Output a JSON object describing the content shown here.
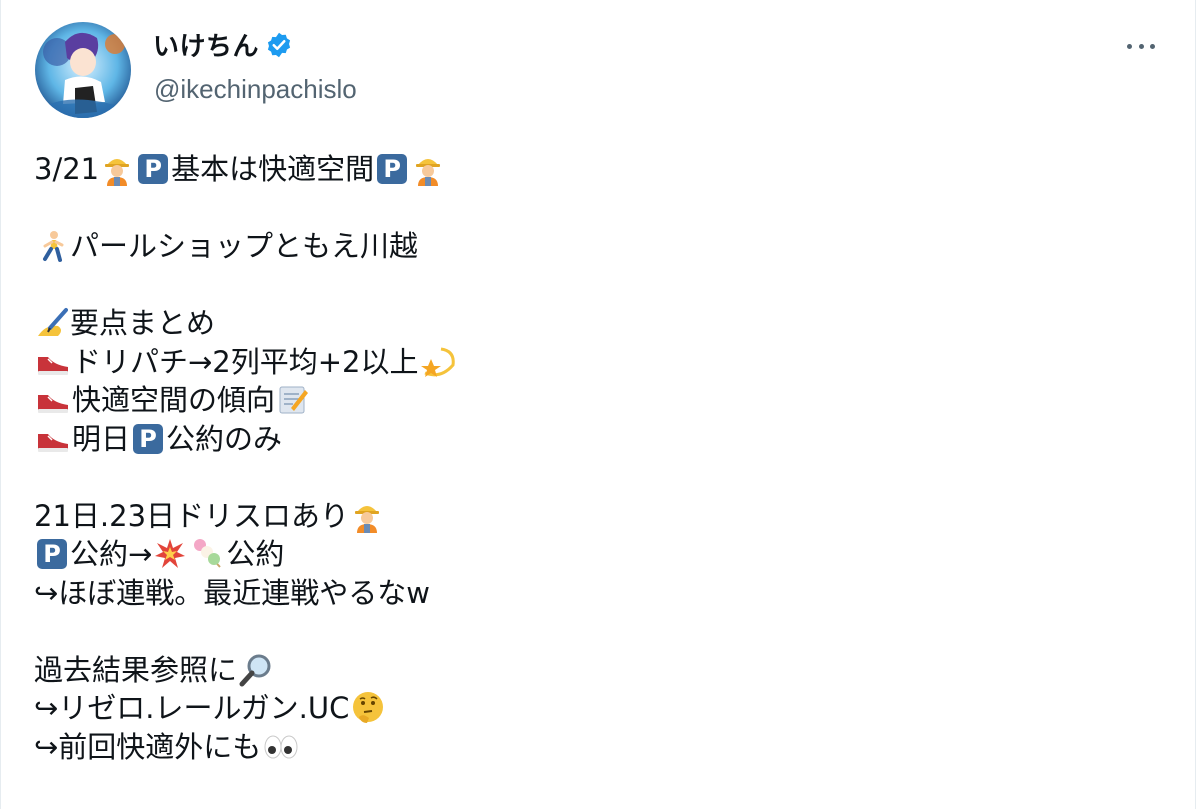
{
  "author": {
    "display_name": "いけちん",
    "handle": "@ikechinpachislo",
    "verified": true
  },
  "icons": {
    "more": "more-horizontal-icon",
    "verified": "verified-badge-icon",
    "parking": "P",
    "worker": "construction-worker-emoji",
    "runner": "runner-emoji",
    "writing": "writing-hand-emoji",
    "shoe": "sneaker-emoji",
    "dizzy": "dizzy-star-emoji",
    "memo": "memo-emoji",
    "collision": "collision-emoji",
    "dango": "dango-emoji",
    "magnifier": "magnifying-glass-emoji",
    "thinking": "thinking-face-emoji",
    "eyes": "eyes-emoji"
  },
  "colors": {
    "verified": "#1d9bf0",
    "parking_box": "#3b6a9e",
    "handle": "#536471"
  },
  "tweet": {
    "l1_prefix": "3/21",
    "l1_mid": "基本は快適空間",
    "l2": "パールショップともえ川越",
    "l3": "要点まとめ",
    "l4": "ドリパチ→2列平均+2以上",
    "l5": "快適空間の傾向",
    "l6_a": "明日",
    "l6_b": "公約のみ",
    "l7": "21日.23日ドリスロあり",
    "l8_a": "公約→",
    "l8_b": "公約",
    "l9": "↪ほぼ連戦。最近連戦やるなw",
    "l10": "過去結果参照に",
    "l11": "↪リゼロ.レールガン.UC",
    "l12": "↪前回快適外にも"
  }
}
